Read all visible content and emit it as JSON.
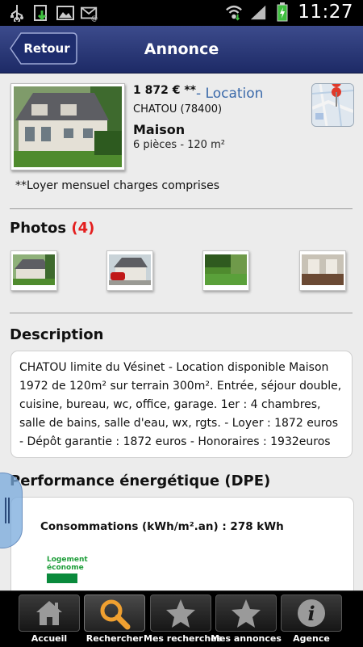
{
  "status_bar": {
    "time": "11:27",
    "icons": [
      "usb-icon",
      "download-icon",
      "image-icon",
      "mail-icon",
      "wifi-icon",
      "signal-icon",
      "battery-charging-icon"
    ]
  },
  "header": {
    "back_label": "Retour",
    "title": "Annonce"
  },
  "listing": {
    "price": "1 872 € **",
    "type": "- Location",
    "city": "CHATOU (78400)",
    "kind": "Maison",
    "rooms": "6 pièces - 120 m²",
    "note": "**Loyer mensuel charges comprises"
  },
  "photos": {
    "title": "Photos",
    "count": "(4)"
  },
  "description": {
    "title": "Description",
    "text": "CHATOU limite du Vésinet - Location disponible Maison 1972 de 120m² sur terrain 300m². Entrée, séjour double, cuisine, bureau, wc, office, garage. 1er : 4 chambres, salle de bains, salle d'eau, wx, rgts. - Loyer : 1872 euros - Dépôt garantie : 1872 euros - Honoraires : 1932euros"
  },
  "dpe": {
    "title": "Performance énergétique (DPE)",
    "consumption": "Consommations (kWh/m².an) : 278 kWh",
    "label_top": "Logement",
    "label_bottom": "économe"
  },
  "tabs": [
    {
      "label": "Accueil",
      "icon": "home-icon"
    },
    {
      "label": "Rechercher",
      "icon": "search-icon"
    },
    {
      "label": "Mes recherches",
      "icon": "star-icon"
    },
    {
      "label": "Mes annonces",
      "icon": "star-icon"
    },
    {
      "label": "Agence",
      "icon": "info-icon"
    }
  ],
  "colors": {
    "header": "#2a3877",
    "accent_blue": "#3b6aaa",
    "count_red": "#e41e1e",
    "search_icon": "#f0a030"
  }
}
